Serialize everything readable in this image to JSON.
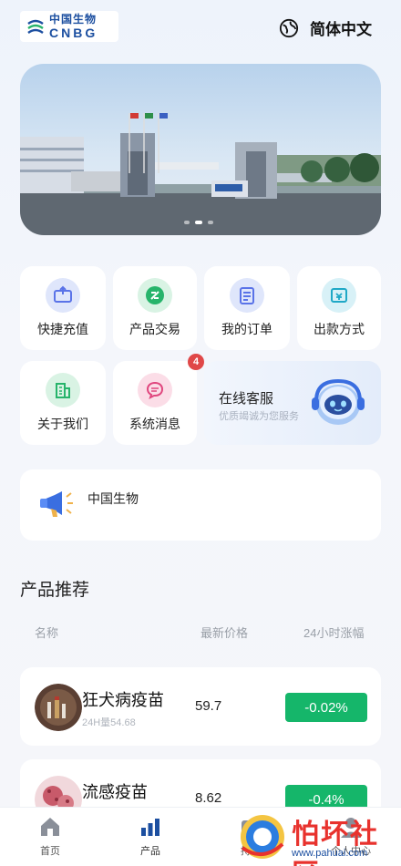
{
  "header": {
    "logo_cn": "中国生物",
    "logo_en": "CNBG",
    "language": "简体中文",
    "language_icon": "globe-icon"
  },
  "banner": {
    "slides": 3,
    "active_slide": 2
  },
  "quick_actions": [
    {
      "label": "快捷充值",
      "icon": "recharge-icon",
      "color": "#5a73e8"
    },
    {
      "label": "产品交易",
      "icon": "trade-icon",
      "color": "#27b46b"
    },
    {
      "label": "我的订单",
      "icon": "order-icon",
      "color": "#5a73e8"
    },
    {
      "label": "出款方式",
      "icon": "withdraw-icon",
      "color": "#1fa8c6"
    },
    {
      "label": "关于我们",
      "icon": "building-icon",
      "color": "#27b46b"
    },
    {
      "label": "系统消息",
      "icon": "message-icon",
      "color": "#e0467e",
      "badge": "4"
    }
  ],
  "service": {
    "title": "在线客服",
    "subtitle": "优质竭诚为您服务",
    "icon": "headset-robot-icon"
  },
  "notice": {
    "text": "中国生物",
    "icon": "megaphone-icon"
  },
  "products": {
    "title": "产品推荐",
    "columns": [
      "名称",
      "最新价格",
      "24小时涨幅"
    ],
    "rows": [
      {
        "name": "狂犬病疫苗",
        "sub": "24H量54.68",
        "price": "59.7",
        "change": "-0.02%"
      },
      {
        "name": "流感疫苗",
        "sub": "",
        "price": "8.62",
        "change": "-0.4%"
      }
    ]
  },
  "tabbar": [
    {
      "label": "首页",
      "icon": "home-icon"
    },
    {
      "label": "产品",
      "icon": "bar-chart-icon"
    },
    {
      "label": "持仓",
      "icon": "wallet-icon"
    },
    {
      "label": "个人中心",
      "icon": "user-icon"
    }
  ],
  "watermark": {
    "text": "怕坏社区",
    "url": "www.pahuai.com"
  },
  "colors": {
    "accent": "#1c4fa0",
    "up_down": "#15b66a",
    "badge": "#e04848"
  }
}
